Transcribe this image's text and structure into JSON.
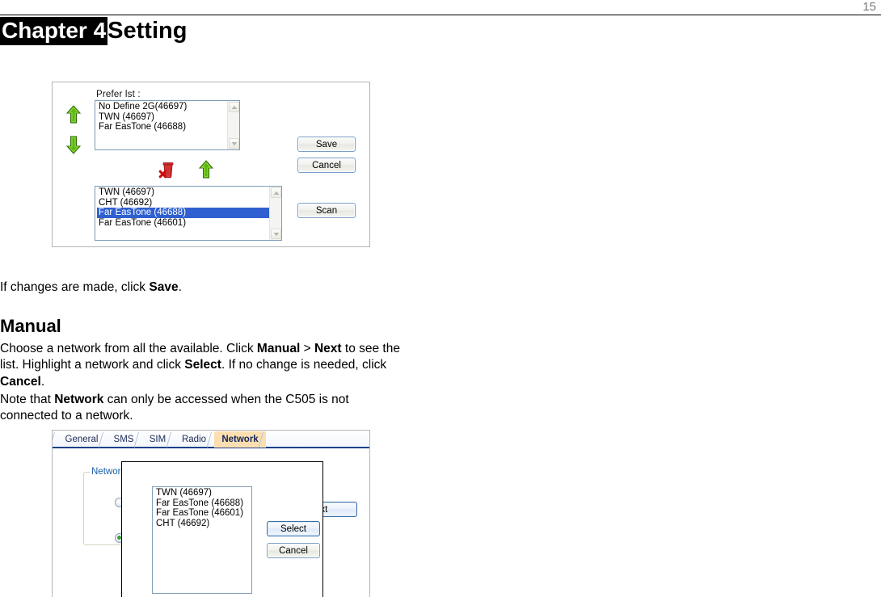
{
  "page": {
    "number": "15"
  },
  "chapter": {
    "label": "Chapter 4",
    "name": "Setting"
  },
  "body": {
    "para_save": {
      "before": "If changes are made, click ",
      "bold": "Save",
      "after": "."
    },
    "heading_manual": "Manual",
    "para_manual": {
      "seg1": "Choose a network from all the available. Click ",
      "bold1": "Manual",
      "seg2": " > ",
      "bold2": "Next",
      "seg3": " to see the list. Highlight a network and click ",
      "bold3": "Select",
      "seg4": ". If no change is needed, click ",
      "bold4": "Cancel",
      "seg5": "."
    },
    "para_note": {
      "seg1": "Note that ",
      "bold1": "Network",
      "seg2": " can only be accessed when the C505 is not connected to a network."
    }
  },
  "figure_prefer": {
    "label": "Prefer lst :",
    "prefer_list": [
      {
        "text": "No Define 2G(46697)",
        "selected": false
      },
      {
        "text": "TWN (46697)",
        "selected": false
      },
      {
        "text": "Far EasTone (46688)",
        "selected": false
      }
    ],
    "scan_list": [
      {
        "text": "TWN (46697)",
        "selected": false
      },
      {
        "text": "CHT (46692)",
        "selected": false
      },
      {
        "text": "Far EasTone (46688)",
        "selected": true
      },
      {
        "text": "Far EasTone (46601)",
        "selected": false
      }
    ],
    "buttons": {
      "save": "Save",
      "cancel": "Cancel",
      "scan": "Scan"
    },
    "icons": {
      "move_up": "arrow-up-icon",
      "move_down": "arrow-down-icon",
      "delete": "trash-delete-icon",
      "add_up": "arrow-up-icon"
    },
    "colors": {
      "arrow_green": "#4fa713",
      "trash_red": "#d62020",
      "selection_blue": "#2f5fd0"
    }
  },
  "figure_network": {
    "tabs": [
      {
        "label": "General",
        "active": false
      },
      {
        "label": "SMS",
        "active": false
      },
      {
        "label": "SIM",
        "active": false
      },
      {
        "label": "Radio",
        "active": false
      },
      {
        "label": "Network",
        "active": true
      }
    ],
    "groupbox_title": "Network",
    "radios": [
      {
        "selected": false
      },
      {
        "selected": true
      }
    ],
    "next_button": "ext",
    "dialog": {
      "network_list": [
        {
          "text": "TWN (46697)",
          "selected": false
        },
        {
          "text": "Far EasTone (46688)",
          "selected": false
        },
        {
          "text": "Far EasTone (46601)",
          "selected": false
        },
        {
          "text": "CHT (46692)",
          "selected": false
        }
      ],
      "buttons": {
        "select": "Select",
        "cancel": "Cancel"
      }
    },
    "colors": {
      "active_tab": "#fbdfb0",
      "tab_text": "#13255a",
      "groupbox_label": "#1b5fa8"
    }
  }
}
